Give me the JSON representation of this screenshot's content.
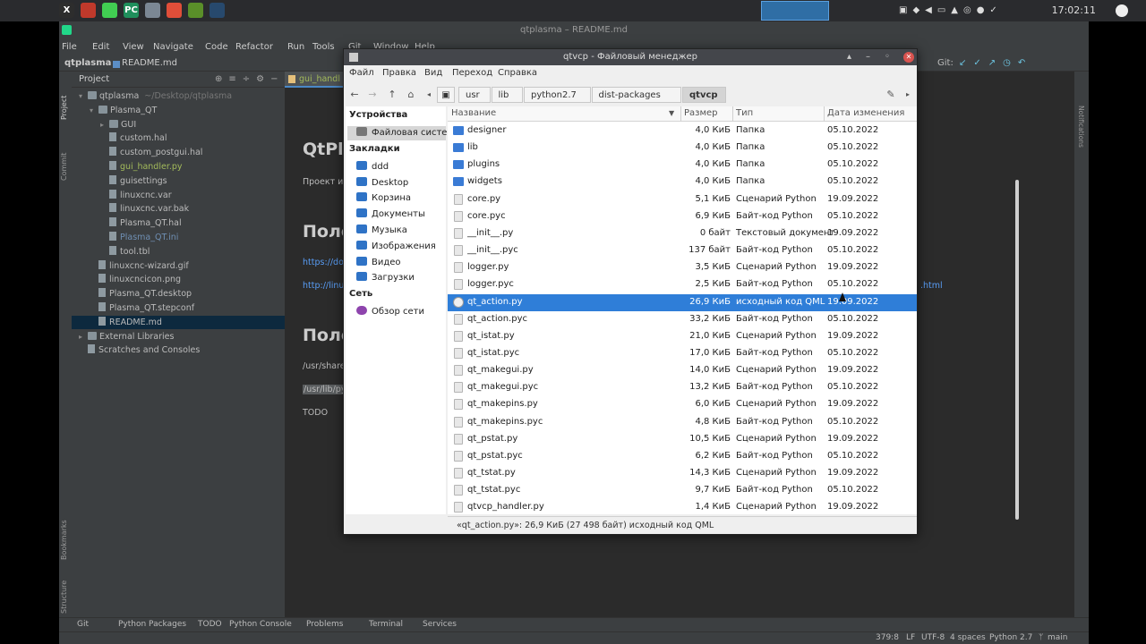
{
  "topbar": {
    "apps": [
      {
        "icon": "x-logo-icon",
        "label": "X",
        "color": "#2d2d2d"
      },
      {
        "icon": "recorder-icon",
        "label": "",
        "color": "#c0392b"
      },
      {
        "icon": "qt-icon",
        "label": "",
        "color": "#41cd52"
      },
      {
        "icon": "pycharm-icon",
        "label": "PC",
        "color": "#1f8f5c"
      },
      {
        "icon": "files-icon",
        "label": "",
        "color": "#7b8794"
      },
      {
        "icon": "chrome-icon",
        "label": "",
        "color": "#e04e39"
      },
      {
        "icon": "editor-icon",
        "label": "",
        "color": "#5a8f29"
      },
      {
        "icon": "window-icon",
        "label": "",
        "color": "#27496d"
      }
    ],
    "clock": "17:02:11"
  },
  "ide": {
    "title": "qtplasma – README.md",
    "menu": [
      "File",
      "Edit",
      "View",
      "Navigate",
      "Code",
      "Refactor",
      "Run",
      "Tools",
      "Git",
      "Window",
      "Help"
    ],
    "breadcrumb": {
      "project": "qtplasma",
      "file": "README.md"
    },
    "git_label": "Git:",
    "editor_tab": "gui_handl",
    "project_panel": {
      "title": "Project",
      "items": [
        {
          "label": "qtplasma",
          "suffix": "~/Desktop/qtplasma",
          "depth": 0,
          "type": "folder",
          "open": true
        },
        {
          "label": "Plasma_QT",
          "depth": 1,
          "type": "folder",
          "open": true
        },
        {
          "label": "GUI",
          "depth": 2,
          "type": "folder",
          "open": false
        },
        {
          "label": "custom.hal",
          "depth": 2,
          "type": "file"
        },
        {
          "label": "custom_postgui.hal",
          "depth": 2,
          "type": "file"
        },
        {
          "label": "gui_handler.py",
          "depth": 2,
          "type": "file",
          "color": "#a3bb5b"
        },
        {
          "label": "guisettings",
          "depth": 2,
          "type": "file"
        },
        {
          "label": "linuxcnc.var",
          "depth": 2,
          "type": "file"
        },
        {
          "label": "linuxcnc.var.bak",
          "depth": 2,
          "type": "file"
        },
        {
          "label": "Plasma_QT.hal",
          "depth": 2,
          "type": "file"
        },
        {
          "label": "Plasma_QT.ini",
          "depth": 2,
          "type": "file",
          "color": "#6f8fb3"
        },
        {
          "label": "tool.tbl",
          "depth": 2,
          "type": "file"
        },
        {
          "label": "linuxcnc-wizard.gif",
          "depth": 1,
          "type": "file"
        },
        {
          "label": "linuxcncicon.png",
          "depth": 1,
          "type": "file"
        },
        {
          "label": "Plasma_QT.desktop",
          "depth": 1,
          "type": "file"
        },
        {
          "label": "Plasma_QT.stepconf",
          "depth": 1,
          "type": "file"
        },
        {
          "label": "README.md",
          "depth": 1,
          "type": "file",
          "selected": true
        },
        {
          "label": "External Libraries",
          "depth": 0,
          "type": "folder",
          "open": false
        },
        {
          "label": "Scratches and Consoles",
          "depth": 0,
          "type": "file"
        }
      ]
    },
    "editor": {
      "h1": "QtPl",
      "p1": "Проект ин",
      "h2a": "Поле",
      "link1": "https://doc",
      "link2": "http://linux",
      "link2_tail": ".html",
      "h2b": "Поле",
      "path1": "/usr/share,",
      "path2": "/usr/lib/py",
      "todo": "TODO"
    },
    "bottom_tools": [
      "Git",
      "Python Packages",
      "TODO",
      "Python Console",
      "Problems",
      "Terminal",
      "Services"
    ],
    "status": {
      "pos": "379:8",
      "eol": "LF",
      "enc": "UTF-8",
      "indent": "4 spaces",
      "interp": "Python 2.7",
      "branch": "main"
    },
    "left_tabs": [
      "Project",
      "Commit",
      "Bookmarks",
      "Structure"
    ],
    "right_tab": "Notifications"
  },
  "fm": {
    "title": "qtvcp - Файловый менеджер",
    "menu": [
      "Файл",
      "Правка",
      "Вид",
      "Переход",
      "Справка"
    ],
    "path": [
      "usr",
      "lib",
      "python2.7",
      "dist-packages",
      "qtvcp"
    ],
    "sidebar": {
      "devices_header": "Устройства",
      "devices": [
        {
          "label": "Файловая систе...",
          "icon": "drive-icon",
          "selected": true
        }
      ],
      "bookmarks_header": "Закладки",
      "bookmarks": [
        {
          "label": "ddd",
          "icon": "home-icon"
        },
        {
          "label": "Desktop",
          "icon": "desktop-folder-icon"
        },
        {
          "label": "Корзина",
          "icon": "trash-icon"
        },
        {
          "label": "Документы",
          "icon": "documents-folder-icon"
        },
        {
          "label": "Музыка",
          "icon": "music-folder-icon"
        },
        {
          "label": "Изображения",
          "icon": "pictures-folder-icon"
        },
        {
          "label": "Видео",
          "icon": "video-folder-icon"
        },
        {
          "label": "Загрузки",
          "icon": "downloads-folder-icon"
        }
      ],
      "network_header": "Сеть",
      "network": [
        {
          "label": "Обзор сети",
          "icon": "network-icon"
        }
      ]
    },
    "columns": {
      "name": "Название",
      "size": "Размер",
      "type": "Тип",
      "date": "Дата изменения"
    },
    "files": [
      {
        "name": "designer",
        "size": "4,0 КиБ",
        "type": "Папка",
        "date": "05.10.2022",
        "kind": "folder"
      },
      {
        "name": "lib",
        "size": "4,0 КиБ",
        "type": "Папка",
        "date": "05.10.2022",
        "kind": "folder"
      },
      {
        "name": "plugins",
        "size": "4,0 КиБ",
        "type": "Папка",
        "date": "05.10.2022",
        "kind": "folder"
      },
      {
        "name": "widgets",
        "size": "4,0 КиБ",
        "type": "Папка",
        "date": "05.10.2022",
        "kind": "folder"
      },
      {
        "name": "core.py",
        "size": "5,1 КиБ",
        "type": "Сценарий Python",
        "date": "19.09.2022",
        "kind": "py"
      },
      {
        "name": "core.pyc",
        "size": "6,9 КиБ",
        "type": "Байт-код Python",
        "date": "05.10.2022",
        "kind": "py"
      },
      {
        "name": "__init__.py",
        "size": "0 байт",
        "type": "Текстовый документ",
        "date": "19.09.2022",
        "kind": "py"
      },
      {
        "name": "__init__.pyc",
        "size": "137 байт",
        "type": "Байт-код Python",
        "date": "05.10.2022",
        "kind": "py"
      },
      {
        "name": "logger.py",
        "size": "3,5 КиБ",
        "type": "Сценарий Python",
        "date": "19.09.2022",
        "kind": "py"
      },
      {
        "name": "logger.pyc",
        "size": "2,5 КиБ",
        "type": "Байт-код Python",
        "date": "05.10.2022",
        "kind": "py"
      },
      {
        "name": "qt_action.py",
        "size": "26,9 КиБ",
        "type": "исходный код QML",
        "date": "19.09.2022",
        "kind": "qml",
        "selected": true
      },
      {
        "name": "qt_action.pyc",
        "size": "33,2 КиБ",
        "type": "Байт-код Python",
        "date": "05.10.2022",
        "kind": "py"
      },
      {
        "name": "qt_istat.py",
        "size": "21,0 КиБ",
        "type": "Сценарий Python",
        "date": "19.09.2022",
        "kind": "py"
      },
      {
        "name": "qt_istat.pyc",
        "size": "17,0 КиБ",
        "type": "Байт-код Python",
        "date": "05.10.2022",
        "kind": "py"
      },
      {
        "name": "qt_makegui.py",
        "size": "14,0 КиБ",
        "type": "Сценарий Python",
        "date": "19.09.2022",
        "kind": "py"
      },
      {
        "name": "qt_makegui.pyc",
        "size": "13,2 КиБ",
        "type": "Байт-код Python",
        "date": "05.10.2022",
        "kind": "py"
      },
      {
        "name": "qt_makepins.py",
        "size": "6,0 КиБ",
        "type": "Сценарий Python",
        "date": "19.09.2022",
        "kind": "py"
      },
      {
        "name": "qt_makepins.pyc",
        "size": "4,8 КиБ",
        "type": "Байт-код Python",
        "date": "05.10.2022",
        "kind": "py"
      },
      {
        "name": "qt_pstat.py",
        "size": "10,5 КиБ",
        "type": "Сценарий Python",
        "date": "19.09.2022",
        "kind": "py"
      },
      {
        "name": "qt_pstat.pyc",
        "size": "6,2 КиБ",
        "type": "Байт-код Python",
        "date": "05.10.2022",
        "kind": "py"
      },
      {
        "name": "qt_tstat.py",
        "size": "14,3 КиБ",
        "type": "Сценарий Python",
        "date": "19.09.2022",
        "kind": "py"
      },
      {
        "name": "qt_tstat.pyc",
        "size": "9,7 КиБ",
        "type": "Байт-код Python",
        "date": "05.10.2022",
        "kind": "py"
      },
      {
        "name": "qtvcp_handler.py",
        "size": "1,4 КиБ",
        "type": "Сценарий Python",
        "date": "19.09.2022",
        "kind": "py"
      }
    ],
    "status": "«qt_action.py»: 26,9 КиБ (27 498 байт) исходный код QML"
  }
}
